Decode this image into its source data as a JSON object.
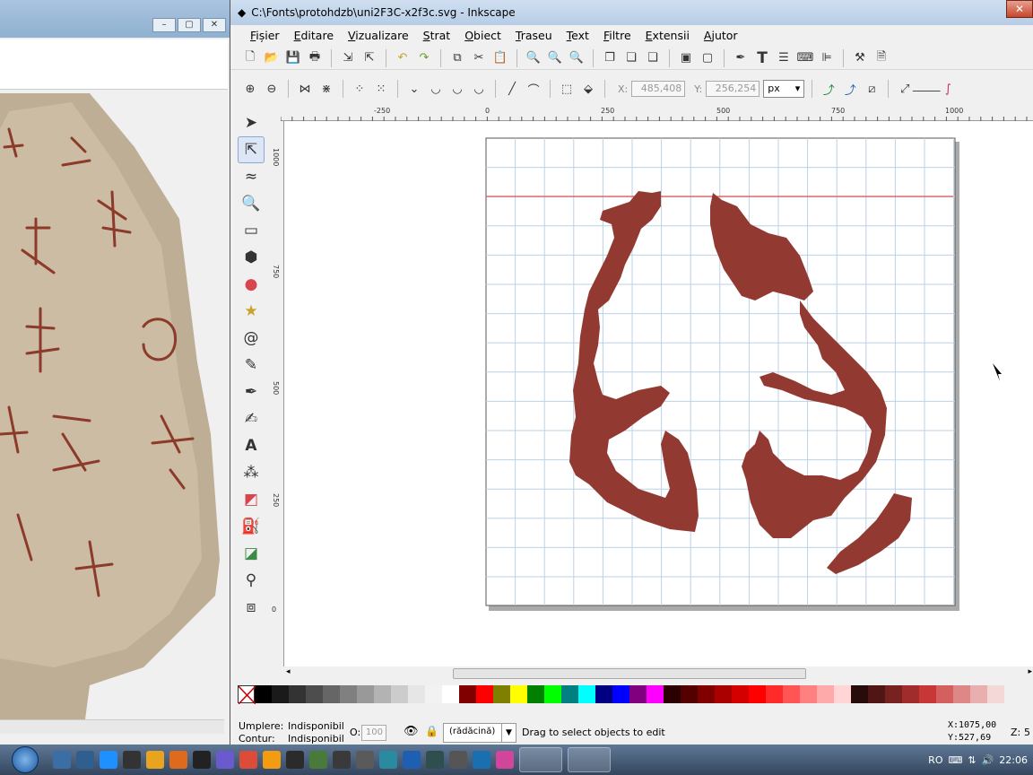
{
  "background_window": {
    "controls": [
      "–",
      "▢",
      "✕"
    ]
  },
  "inkscape": {
    "title": "C:\\Fonts\\protohdzb\\uni2F3C-x2f3c.svg - Inkscape",
    "menu": [
      "Fișier",
      "Editare",
      "Vizualizare",
      "Strat",
      "Obiect",
      "Traseu",
      "Text",
      "Filtre",
      "Extensii",
      "Ajutor"
    ],
    "coords": {
      "x_label": "X:",
      "x_value": "485,408",
      "y_label": "Y:",
      "y_value": "256,254",
      "unit": "px"
    },
    "ruler_h_labels": [
      "-250",
      "0",
      "250",
      "500",
      "750",
      "1000"
    ],
    "ruler_v_labels": [
      "1000",
      "750",
      "500",
      "250",
      "0"
    ],
    "status": {
      "fill_label": "Umplere:",
      "fill_value": "Indisponibil",
      "stroke_label": "Contur:",
      "stroke_value": "Indisponibil",
      "opacity_label": "O:",
      "opacity_value": "100",
      "layer": "(rădăcină)",
      "message": "Drag to select objects to edit",
      "cursor_x_label": "X:",
      "cursor_x": "1075,00",
      "cursor_y_label": "Y:",
      "cursor_y": "527,69",
      "zoom_label": "Z:",
      "zoom": "5"
    },
    "glyph_color": "#923a31",
    "palette": [
      "#000000",
      "#1a1a1a",
      "#333333",
      "#4d4d4d",
      "#666666",
      "#808080",
      "#999999",
      "#b3b3b3",
      "#cccccc",
      "#e6e6e6",
      "#f2f2f2",
      "#ffffff",
      "#800000",
      "#ff0000",
      "#808000",
      "#ffff00",
      "#008000",
      "#00ff00",
      "#008080",
      "#00ffff",
      "#000080",
      "#0000ff",
      "#800080",
      "#ff00ff",
      "#2b0000",
      "#550000",
      "#800000",
      "#aa0000",
      "#d40000",
      "#ff0000",
      "#ff2a2a",
      "#ff5555",
      "#ff8080",
      "#ffaaaa",
      "#ffd5d5",
      "#280b0b",
      "#501616",
      "#782121",
      "#a02c2c",
      "#c83737",
      "#d35f5f",
      "#de8787",
      "#e9afaf",
      "#f4d7d7"
    ]
  },
  "taskbar": {
    "lang": "RO",
    "time": "22:06",
    "app_icons": [
      "explorer-icon",
      "store-icon",
      "ie-icon",
      "save-icon",
      "media-icon",
      "firefox-icon",
      "cmd-icon",
      "php-icon",
      "chrome-icon",
      "orb-icon",
      "game-icon",
      "app-icon",
      "tool-icon",
      "gear-icon",
      "net-icon",
      "globe-icon",
      "box-icon",
      "calc-icon",
      "monitor-icon",
      "pink-icon"
    ]
  }
}
